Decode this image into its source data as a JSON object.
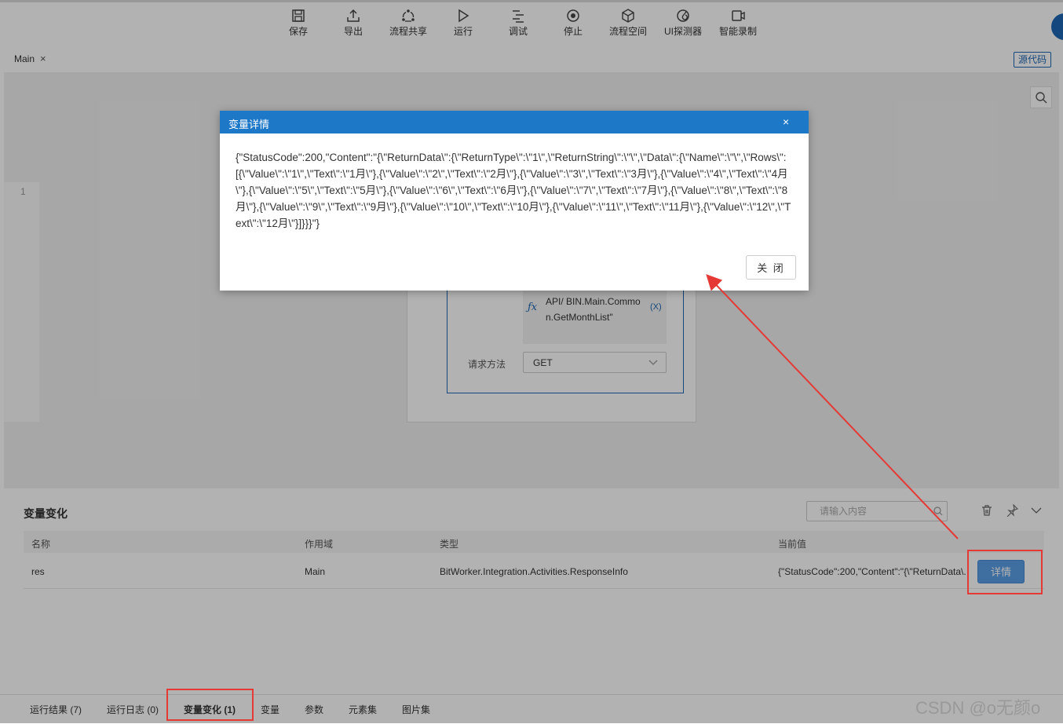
{
  "toolbar": {
    "items": [
      {
        "label": "保存",
        "icon": "save-icon"
      },
      {
        "label": "导出",
        "icon": "export-icon"
      },
      {
        "label": "流程共享",
        "icon": "share-icon"
      },
      {
        "label": "运行",
        "icon": "run-icon"
      },
      {
        "label": "调试",
        "icon": "debug-icon"
      },
      {
        "label": "停止",
        "icon": "stop-icon"
      },
      {
        "label": "流程空间",
        "icon": "cube-icon"
      },
      {
        "label": "UI探测器",
        "icon": "detector-icon"
      },
      {
        "label": "智能录制",
        "icon": "record-icon"
      }
    ]
  },
  "tabs": {
    "main": "Main",
    "source_code": "源代码"
  },
  "editor": {
    "line_number": "1",
    "activity": {
      "url": "API/ BIN.Main.Common.GetMonthList\"",
      "fx": "ƒx",
      "var_button": "(X)",
      "method_label": "请求方法",
      "method_value": "GET"
    }
  },
  "dialog": {
    "title": "变量详情",
    "close_icon": "×",
    "content": "{\"StatusCode\":200,\"Content\":\"{\\\"ReturnData\\\":{\\\"ReturnType\\\":\\\"1\\\",\\\"ReturnString\\\":\\\"\\\",\\\"Data\\\":{\\\"Name\\\":\\\"\\\",\\\"Rows\\\":[{\\\"Value\\\":\\\"1\\\",\\\"Text\\\":\\\"1月\\\"},{\\\"Value\\\":\\\"2\\\",\\\"Text\\\":\\\"2月\\\"},{\\\"Value\\\":\\\"3\\\",\\\"Text\\\":\\\"3月\\\"},{\\\"Value\\\":\\\"4\\\",\\\"Text\\\":\\\"4月\\\"},{\\\"Value\\\":\\\"5\\\",\\\"Text\\\":\\\"5月\\\"},{\\\"Value\\\":\\\"6\\\",\\\"Text\\\":\\\"6月\\\"},{\\\"Value\\\":\\\"7\\\",\\\"Text\\\":\\\"7月\\\"},{\\\"Value\\\":\\\"8\\\",\\\"Text\\\":\\\"8月\\\"},{\\\"Value\\\":\\\"9\\\",\\\"Text\\\":\\\"9月\\\"},{\\\"Value\\\":\\\"10\\\",\\\"Text\\\":\\\"10月\\\"},{\\\"Value\\\":\\\"11\\\",\\\"Text\\\":\\\"11月\\\"},{\\\"Value\\\":\\\"12\\\",\\\"Text\\\":\\\"12月\\\"}]}}}\"}",
    "close_button": "关 闭"
  },
  "panel": {
    "title": "变量变化",
    "search_placeholder": "请输入内容",
    "columns": [
      "名称",
      "作用域",
      "类型",
      "当前值"
    ],
    "rows": [
      {
        "name": "res",
        "scope": "Main",
        "type": "BitWorker.Integration.Activities.ResponseInfo",
        "value": "{\"StatusCode\":200,\"Content\":\"{\\\"ReturnData\\...",
        "action": "详情"
      }
    ]
  },
  "bottom_tabs": [
    "运行结果 (7)",
    "运行日志 (0)",
    "变量变化 (1)",
    "变量",
    "参数",
    "元素集",
    "图片集"
  ],
  "watermark": "CSDN @o无颜o",
  "colors": {
    "accent": "#1e78c8",
    "highlight": "#e53935"
  }
}
